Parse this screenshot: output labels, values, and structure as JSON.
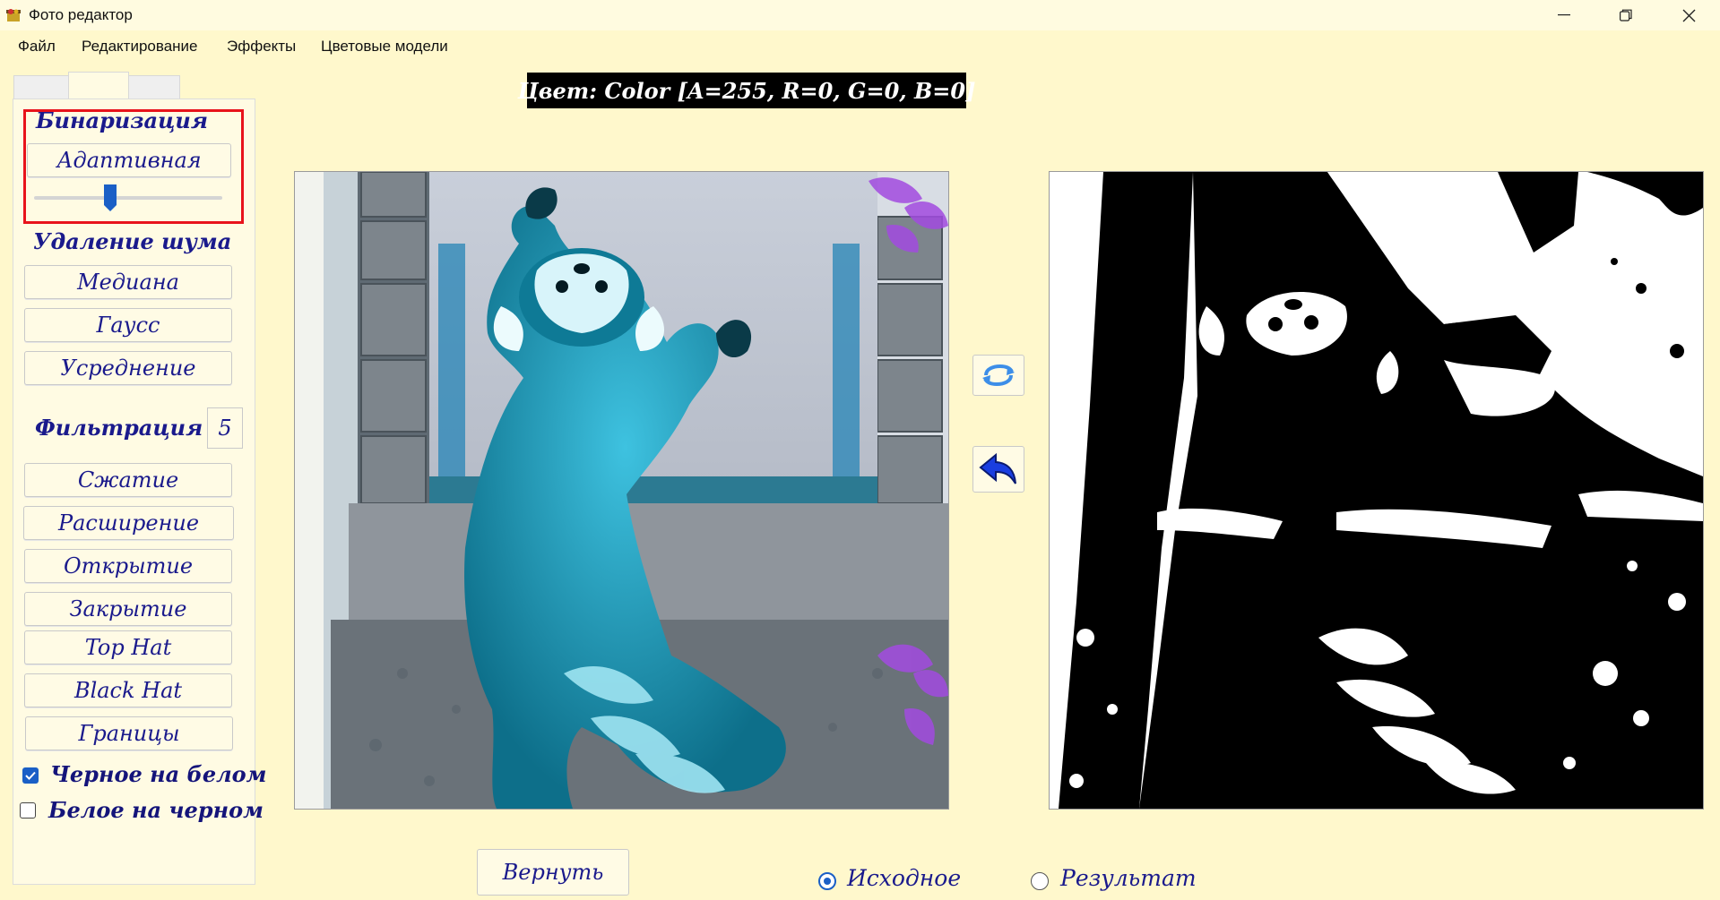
{
  "window": {
    "title": "Фото редактор"
  },
  "menu": [
    "Файл",
    "Редактирование",
    "Эффекты",
    "Цветовые модели"
  ],
  "panel": {
    "binarization_title": "Бинаризация",
    "adaptive_button": "Адаптивная",
    "slider_value": 0.35,
    "noise_title": "Удаление шума",
    "noise_buttons": [
      "Медиана",
      "Гаусс",
      "Усреднение"
    ],
    "filter_title": "Фильтрация",
    "filter_size": "5",
    "filter_buttons": [
      "Сжатие",
      "Расширение",
      "Открытие",
      "Закрытие",
      "Top Hat",
      "Black Hat",
      "Границы"
    ],
    "black_on_white": {
      "label": "Черное на белом",
      "checked": true
    },
    "white_on_black": {
      "label": "Белое на черном",
      "checked": false
    }
  },
  "color_label": "Цвет: Color [A=255, R=0, G=0, B=0]",
  "return_button": "Вернуть",
  "radio": {
    "source": "Исходное",
    "result": "Результат",
    "selected": "source"
  },
  "icons": {
    "rotate": "rotate-icon",
    "undo": "undo-arrow-icon"
  },
  "colors": {
    "background": "#fff8cc",
    "accent": "#1a5fc6",
    "text": "#1a1a8c",
    "highlight": "#e8131b"
  }
}
